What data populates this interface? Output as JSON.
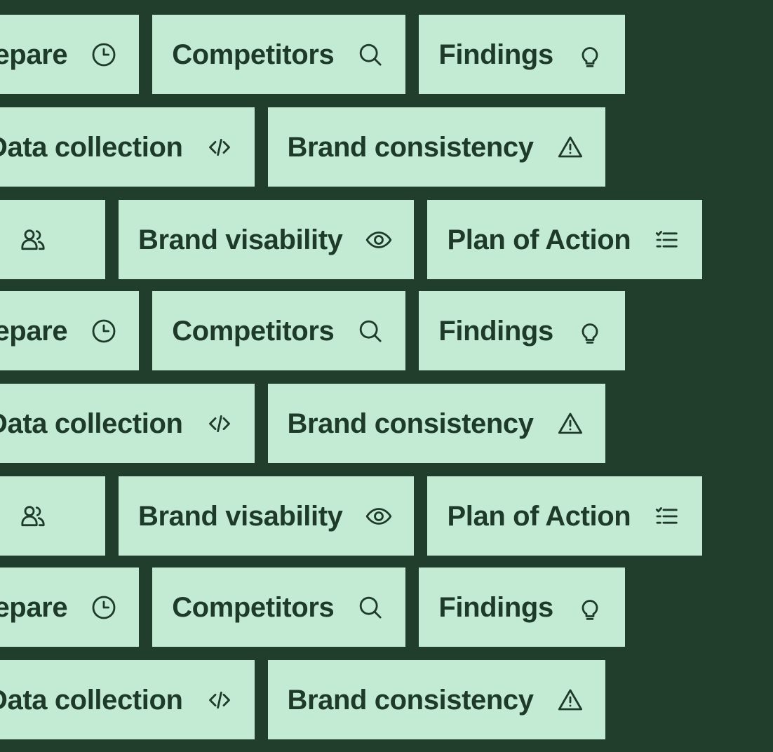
{
  "theme": {
    "background_color": "#213D2B",
    "pill_color": "#C3EBD4",
    "text_color": "#1E3A28"
  },
  "tags": {
    "prepare": {
      "label": "Prepare",
      "icon": "clock-icon"
    },
    "competitors": {
      "label": "Competitors",
      "icon": "search-icon"
    },
    "findings": {
      "label": "Findings",
      "icon": "lightbulb-icon"
    },
    "data_collection": {
      "label": "Data collection",
      "icon": "code-icon"
    },
    "brand_consistency": {
      "label": "Brand consistency",
      "icon": "warning-icon"
    },
    "audience": {
      "label": "",
      "icon": "people-icon"
    },
    "brand_visability": {
      "label": "Brand visability",
      "icon": "eye-icon"
    },
    "plan_of_action": {
      "label": "Plan of Action",
      "icon": "checklist-icon"
    }
  },
  "rows": [
    {
      "index": 1,
      "pattern": "a",
      "items": [
        "prepare",
        "competitors",
        "findings"
      ]
    },
    {
      "index": 2,
      "pattern": "b",
      "items": [
        "data_collection",
        "brand_consistency"
      ]
    },
    {
      "index": 3,
      "pattern": "c",
      "items": [
        "audience",
        "brand_visability",
        "plan_of_action"
      ]
    },
    {
      "index": 4,
      "pattern": "a",
      "items": [
        "prepare",
        "competitors",
        "findings"
      ]
    },
    {
      "index": 5,
      "pattern": "b",
      "items": [
        "data_collection",
        "brand_consistency"
      ]
    },
    {
      "index": 6,
      "pattern": "c",
      "items": [
        "audience",
        "brand_visability",
        "plan_of_action"
      ]
    },
    {
      "index": 7,
      "pattern": "a",
      "items": [
        "prepare",
        "competitors",
        "findings"
      ]
    },
    {
      "index": 8,
      "pattern": "b",
      "items": [
        "data_collection",
        "brand_consistency"
      ]
    }
  ]
}
